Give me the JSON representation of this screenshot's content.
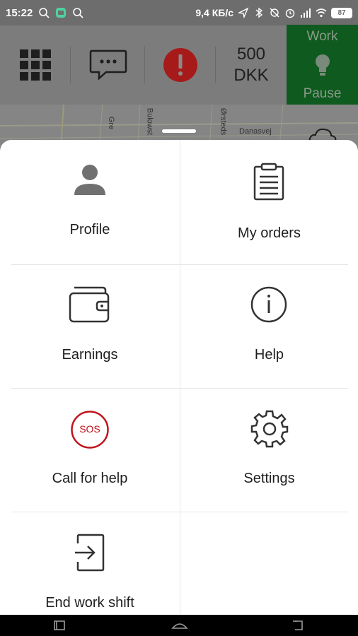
{
  "status_bar": {
    "time": "15:22",
    "network_speed": "9,4 КБ/с",
    "battery_level": "87",
    "icons": [
      "search-icon",
      "notification-icon",
      "search-icon",
      "bluetooth-icon",
      "location-icon",
      "alarm-icon",
      "signal-icon",
      "wifi-icon",
      "battery-icon"
    ]
  },
  "appbar": {
    "balance_amount": "500",
    "balance_currency": "DKK",
    "work_label": "Work",
    "pause_label": "Pause",
    "alert_color": "#b31b1b",
    "work_bg_color": "#0f5a1f"
  },
  "map": {
    "streets": [
      "Gre",
      "Bulowst",
      "Ørsteds",
      "Danasvej"
    ]
  },
  "menu": {
    "items": [
      {
        "label": "Profile",
        "icon": "profile-icon"
      },
      {
        "label": "My orders",
        "icon": "clipboard-icon"
      },
      {
        "label": "Earnings",
        "icon": "wallet-icon"
      },
      {
        "label": "Help",
        "icon": "info-icon"
      },
      {
        "label": "Call for help",
        "icon": "sos-icon",
        "icon_text": "SOS"
      },
      {
        "label": "Settings",
        "icon": "gear-icon"
      },
      {
        "label": "End work shift",
        "icon": "exit-icon"
      }
    ],
    "sos_color": "#c0141e"
  }
}
